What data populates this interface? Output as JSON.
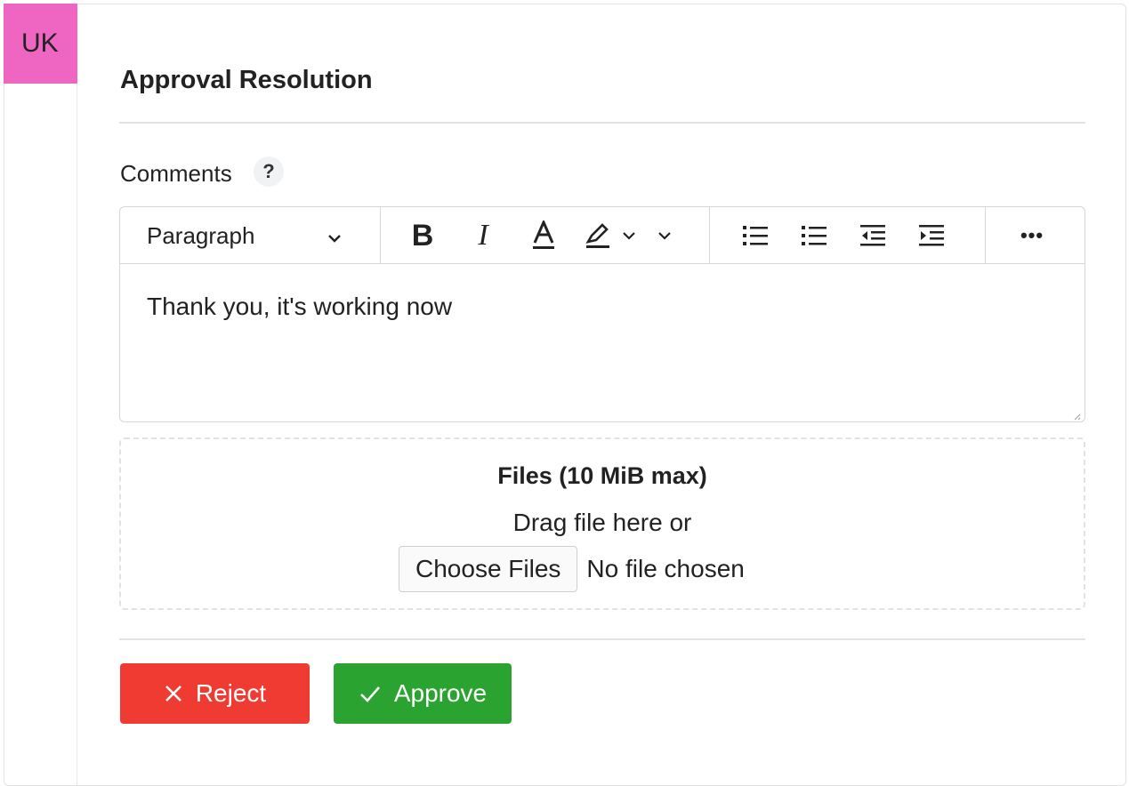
{
  "avatar": {
    "initials": "UK",
    "color": "#ee66c2"
  },
  "panel": {
    "title": "Approval Resolution"
  },
  "comments": {
    "label": "Comments",
    "help_icon": "question-mark-icon",
    "help_glyph": "?"
  },
  "editor": {
    "toolbar": {
      "block_format": "Paragraph",
      "bold_glyph": "B",
      "italic_glyph": "I",
      "more_glyph": "•••",
      "icons": [
        "chevron-down-icon",
        "bold-icon",
        "italic-icon",
        "font-color-icon",
        "highlight-icon",
        "bullet-list-icon",
        "numbered-list-icon",
        "outdent-icon",
        "indent-icon",
        "more-icon"
      ]
    },
    "content": "Thank you, it's working now"
  },
  "files": {
    "title": "Files (10 MiB max)",
    "drag_text": "Drag file here or",
    "choose_label": "Choose Files",
    "status": "No file chosen"
  },
  "actions": {
    "reject_label": "Reject",
    "reject_icon": "close-icon",
    "reject_color": "#ef3b32",
    "approve_label": "Approve",
    "approve_icon": "check-icon",
    "approve_color": "#2ba330"
  }
}
